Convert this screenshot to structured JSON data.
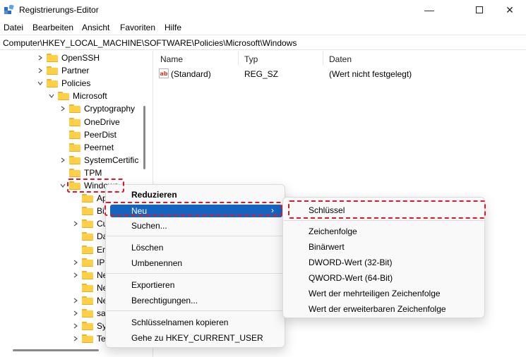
{
  "window": {
    "title": "Registrierungs-Editor"
  },
  "menubar": {
    "items": [
      "Datei",
      "Bearbeiten",
      "Ansicht",
      "Favoriten",
      "Hilfe"
    ]
  },
  "address": {
    "path": "Computer\\HKEY_LOCAL_MACHINE\\SOFTWARE\\Policies\\Microsoft\\Windows"
  },
  "tree": {
    "items": [
      {
        "label": "OpenSSH",
        "depth": 2,
        "chevron": "right"
      },
      {
        "label": "Partner",
        "depth": 2,
        "chevron": "right"
      },
      {
        "label": "Policies",
        "depth": 2,
        "chevron": "down"
      },
      {
        "label": "Microsoft",
        "depth": 3,
        "chevron": "down"
      },
      {
        "label": "Cryptography",
        "depth": 4,
        "chevron": "right"
      },
      {
        "label": "OneDrive",
        "depth": 4,
        "chevron": "none"
      },
      {
        "label": "PeerDist",
        "depth": 4,
        "chevron": "none"
      },
      {
        "label": "Peernet",
        "depth": 4,
        "chevron": "none"
      },
      {
        "label": "SystemCertific",
        "depth": 4,
        "chevron": "right"
      },
      {
        "label": "TPM",
        "depth": 4,
        "chevron": "none"
      },
      {
        "label": "Windows",
        "depth": 4,
        "chevron": "down"
      },
      {
        "label": "Ap",
        "depth": 5,
        "chevron": "none"
      },
      {
        "label": "Bi",
        "depth": 5,
        "chevron": "none"
      },
      {
        "label": "Cu",
        "depth": 5,
        "chevron": "right"
      },
      {
        "label": "Da",
        "depth": 5,
        "chevron": "none"
      },
      {
        "label": "Er",
        "depth": 5,
        "chevron": "none"
      },
      {
        "label": "IP",
        "depth": 5,
        "chevron": "right"
      },
      {
        "label": "Ne",
        "depth": 5,
        "chevron": "right"
      },
      {
        "label": "Ne",
        "depth": 5,
        "chevron": "none"
      },
      {
        "label": "Ne",
        "depth": 5,
        "chevron": "right"
      },
      {
        "label": "sa",
        "depth": 5,
        "chevron": "right"
      },
      {
        "label": "Sy",
        "depth": 5,
        "chevron": "right"
      },
      {
        "label": "Te",
        "depth": 5,
        "chevron": "right"
      }
    ]
  },
  "list": {
    "headers": {
      "name": "Name",
      "type": "Typ",
      "data": "Daten"
    },
    "rows": [
      {
        "icon": "string-value-icon",
        "name": "(Standard)",
        "type": "REG_SZ",
        "data": "(Wert nicht festgelegt)"
      }
    ]
  },
  "context_menu": {
    "collapse": "Reduzieren",
    "new": "Neu",
    "find": "Suchen...",
    "delete": "Löschen",
    "rename": "Umbenennen",
    "export": "Exportieren",
    "permissions": "Berechtigungen...",
    "copy_key_name": "Schlüsselnamen kopieren",
    "goto_hkcu": "Gehe zu HKEY_CURRENT_USER"
  },
  "submenu": {
    "key": "Schlüssel",
    "string": "Zeichenfolge",
    "binary": "Binärwert",
    "dword": "DWORD-Wert (32-Bit)",
    "qword": "QWORD-Wert (64-Bit)",
    "multi_string": "Wert der mehrteiligen Zeichenfolge",
    "expandable_string": "Wert der erweiterbaren Zeichenfolge"
  },
  "colors": {
    "highlight": "#1565c0",
    "callout": "#e0162b",
    "folder": "#ffcf48"
  }
}
